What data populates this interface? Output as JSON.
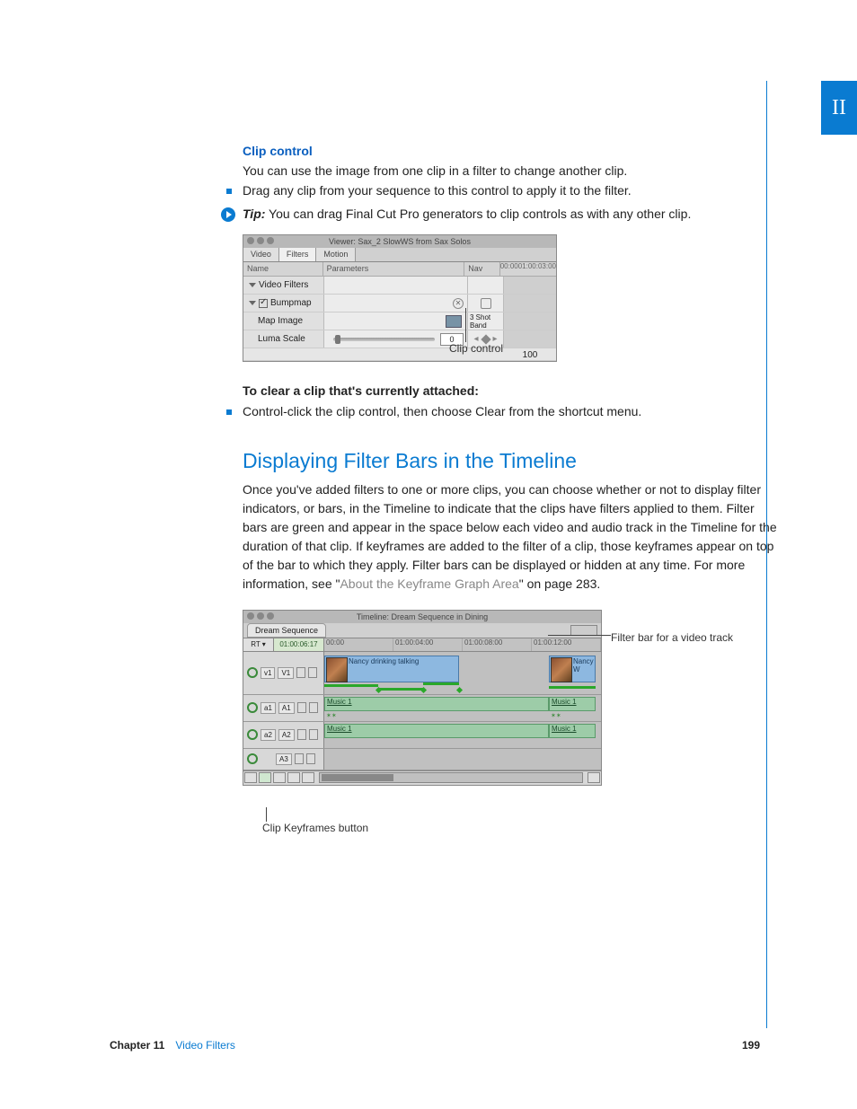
{
  "part_number": "II",
  "section1": {
    "title": "Clip control",
    "intro": "You can use the image from one clip in a filter to change another clip.",
    "bullet": "Drag any clip from your sequence to this control to apply it to the filter.",
    "tip_label": "Tip:",
    "tip_text": "  You can drag Final Cut Pro generators to clip controls as with any other clip."
  },
  "viewer": {
    "title": "Viewer: Sax_2 SlowWS from Sax Solos",
    "tabs": [
      "Video",
      "Filters",
      "Motion"
    ],
    "cols": {
      "name": "Name",
      "params": "Parameters",
      "nav": "Nav"
    },
    "timecodes": [
      "00:00",
      "01:00:03:00"
    ],
    "row1": "Video Filters",
    "row2": "Bumpmap",
    "row3": "Map Image",
    "row3_drag": "3 Shot Band",
    "row4": "Luma Scale",
    "row4_val": "0",
    "bottom_axis": "100",
    "callout": "Clip control"
  },
  "section2": {
    "heading": "To clear a clip that's currently attached:",
    "bullet": "Control-click the clip control, then choose Clear from the shortcut menu."
  },
  "section3": {
    "title": "Displaying Filter Bars in the Timeline",
    "body_a": "Once you've added filters to one or more clips, you can choose whether or not to display filter indicators, or bars, in the Timeline to indicate that the clips have filters applied to them. Filter bars are green and appear in the space below each video and audio track in the Timeline for the duration of that clip. If keyframes are added to the filter of a clip, those keyframes appear on top of the bar to which they apply. Filter bars can be displayed or hidden at any time. For more information, see \"",
    "link": "About the Keyframe Graph Area",
    "body_b": "\" on page 283."
  },
  "timeline": {
    "title": "Timeline: Dream Sequence in Dining",
    "seq_tab": "Dream Sequence",
    "rt": "RT ▾",
    "tc": "01:00:06:17",
    "ruler": [
      "00:00",
      "01:00:04:00",
      "01:00:08:00",
      "01:00:12:00"
    ],
    "v1_src": "v1",
    "v1_dst": "V1",
    "vclip1": "Nancy drinking talking",
    "vclip2": "Nancy W",
    "a1_src": "a1",
    "a1_dst": "A1",
    "a2_src": "a2",
    "a2_dst": "A2",
    "a3_dst": "A3",
    "aclip": "Music 1",
    "callout_top": "Filter bar for a video track",
    "callout_bottom": "Clip Keyframes button"
  },
  "footer": {
    "chapter_label": "Chapter 11",
    "chapter_title": "Video Filters",
    "page": "199"
  }
}
